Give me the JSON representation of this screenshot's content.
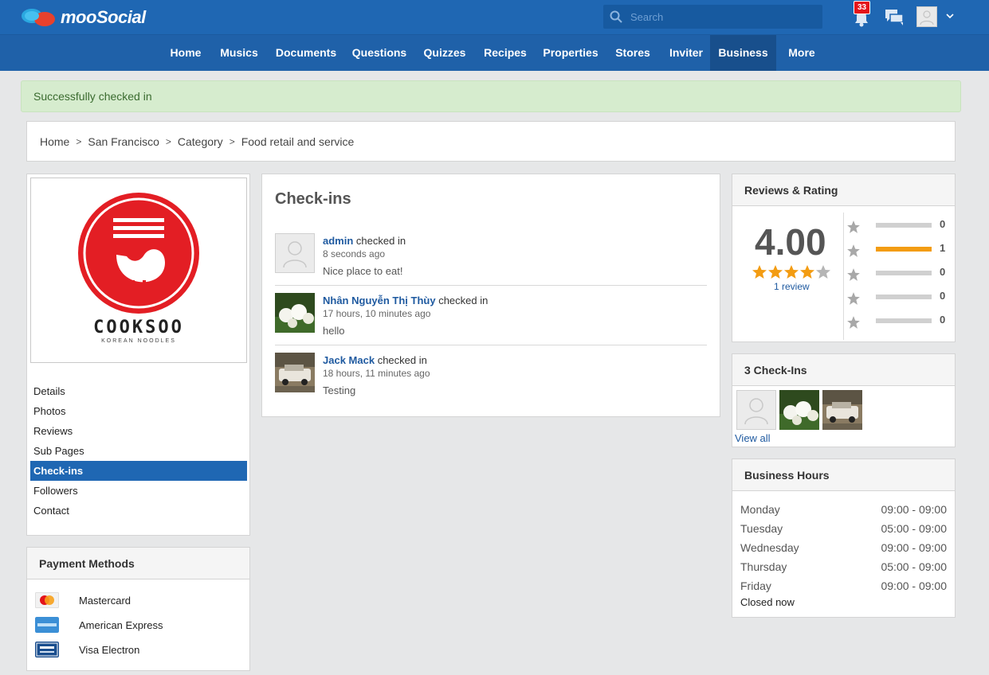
{
  "header": {
    "logo_text": "mooSocial",
    "search_placeholder": "Search",
    "notification_count": "33"
  },
  "nav": {
    "items": [
      "Home",
      "Musics",
      "Documents",
      "Questions",
      "Quizzes",
      "Recipes",
      "Properties",
      "Stores",
      "Inviter",
      "Business",
      "More"
    ],
    "active": "Business"
  },
  "alert": {
    "message": "Successfully checked in"
  },
  "breadcrumb": [
    "Home",
    "San Francisco",
    "Category",
    "Food retail and service"
  ],
  "business": {
    "logo_name": "COOKSOO",
    "logo_tagline": "KOREAN NOODLES",
    "menu": [
      "Details",
      "Photos",
      "Reviews",
      "Sub Pages",
      "Check-ins",
      "Followers",
      "Contact"
    ],
    "active_menu": "Check-ins"
  },
  "payment": {
    "title": "Payment Methods",
    "methods": [
      "Mastercard",
      "American Express",
      "Visa Electron"
    ]
  },
  "checkins": {
    "title": "Check-ins",
    "action_text": "checked in",
    "items": [
      {
        "user": "admin",
        "time": "8 seconds ago",
        "message": "Nice place to eat!",
        "thumb": "default-avatar"
      },
      {
        "user": "Nhân Nguyễn Thị Thùy",
        "time": "17 hours, 10 minutes ago",
        "message": "hello",
        "thumb": "flowers-photo"
      },
      {
        "user": "Jack Mack",
        "time": "18 hours, 11 minutes ago",
        "message": "Testing",
        "thumb": "car-photo"
      }
    ]
  },
  "reviews": {
    "title": "Reviews & Rating",
    "score": "4.00",
    "score_value": 4.0,
    "review_link": "1 review",
    "distribution": [
      {
        "stars": 5,
        "count": "0",
        "fraction": 0
      },
      {
        "stars": 4,
        "count": "1",
        "fraction": 1
      },
      {
        "stars": 3,
        "count": "0",
        "fraction": 0
      },
      {
        "stars": 2,
        "count": "0",
        "fraction": 0
      },
      {
        "stars": 1,
        "count": "0",
        "fraction": 0
      }
    ]
  },
  "checkins_box": {
    "title": "3 Check-Ins",
    "view_all": "View all"
  },
  "hours": {
    "title": "Business Hours",
    "rows": [
      {
        "day": "Monday",
        "time": "09:00 - 09:00"
      },
      {
        "day": "Tuesday",
        "time": "05:00 - 09:00"
      },
      {
        "day": "Wednesday",
        "time": "09:00 - 09:00"
      },
      {
        "day": "Thursday",
        "time": "05:00 - 09:00"
      },
      {
        "day": "Friday",
        "time": "09:00 - 09:00"
      }
    ],
    "status": "Closed now"
  },
  "colors": {
    "primary": "#1f67b3",
    "nav": "#1f61a9",
    "accent_red": "#e5141b",
    "star": "#f39c12"
  }
}
